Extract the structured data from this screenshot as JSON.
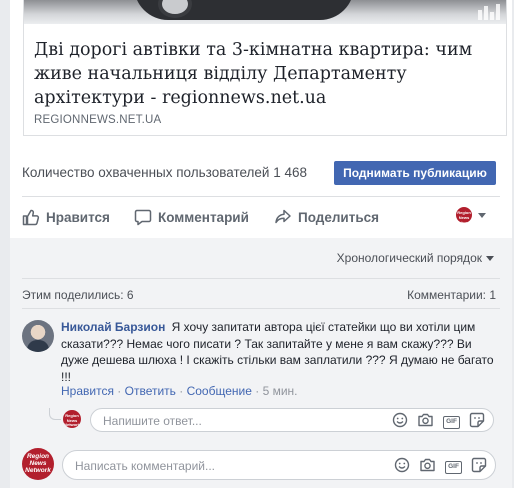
{
  "preview": {
    "title": "Дві дорогі автівки та 3-кімнатна квартира: чим живе начальниця відділу Департаменту архітектури - regionnews.net.ua",
    "domain": "REGIONNEWS.NET.UA"
  },
  "stats": {
    "reach_text": "Количество охваченных пользователей 1 468",
    "boost_label": "Поднимать публикацию"
  },
  "actions": {
    "like_label": "Нравится",
    "comment_label": "Комментарий",
    "share_label": "Поделиться"
  },
  "comments": {
    "order_label": "Хронологический порядок",
    "shared_label": "Этим поделились: 6",
    "count_label": "Комментарии: 1",
    "items": [
      {
        "author": "Николай Барзион",
        "text": "Я хочу запитати автора цієї статейки що ви хотіли цим сказати??? Немає чого писати ? Так запитайте у мене я вам скажу??? Ви дуже дешева шлюха ! І скажіть стільки вам заплатили ??? Я думаю не багато !!!",
        "like": "Нравится",
        "reply": "Ответить",
        "message": "Сообщение",
        "time": "5 мин.",
        "sep": " · "
      }
    ],
    "reply_placeholder": "Напишите ответ...",
    "comment_placeholder": "Написать комментарий..."
  },
  "page_avatar": {
    "lines": [
      "Region",
      "News",
      "Network"
    ]
  },
  "icons": {
    "like": "thumbs-up-icon",
    "comment": "speech-bubble-icon",
    "share": "share-arrow-icon",
    "emoji": "smiley-icon",
    "camera": "camera-icon",
    "gif": "gif-icon",
    "sticker": "sticker-icon",
    "gif_text": "GIF"
  },
  "colors": {
    "accent": "#4267b2",
    "link": "#385898",
    "brand_avatar": "#b21f2d"
  }
}
